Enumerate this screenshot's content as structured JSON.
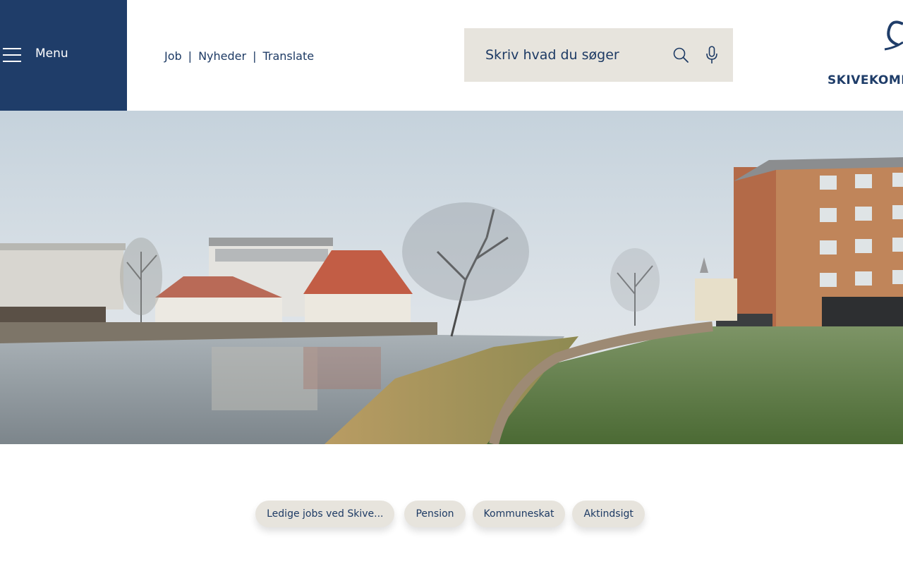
{
  "header": {
    "menu_label": "Menu",
    "links": [
      {
        "label": "Job"
      },
      {
        "label": "Nyheder"
      },
      {
        "label": "Translate"
      }
    ],
    "separator": "|"
  },
  "search": {
    "placeholder": "Skriv hvad du søger",
    "value": ""
  },
  "logo": {
    "text": "SKIVEKOMMUNE"
  },
  "hero": {
    "alt": "Foggy riverside view of Skive with buildings, trees and a grassy path"
  },
  "quicklinks": [
    {
      "label": "Ledige jobs ved Skive..."
    },
    {
      "label": "Pension"
    },
    {
      "label": "Kommuneskat"
    },
    {
      "label": "Aktindsigt"
    }
  ],
  "colors": {
    "brand_navy": "#1f3d69",
    "search_bg": "#e7e4dd",
    "pill_bg": "#e7e4dd"
  }
}
